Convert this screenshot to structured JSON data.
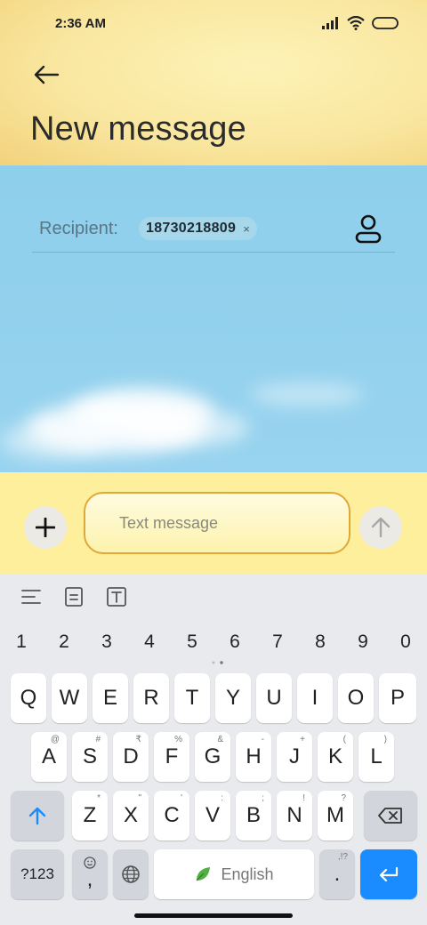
{
  "status_bar": {
    "time": "2:36 AM",
    "icons": [
      "signal-icon",
      "wifi-icon",
      "battery-icon"
    ]
  },
  "header": {
    "back_icon": "back-arrow-icon",
    "title": "New message"
  },
  "recipient": {
    "label": "Recipient:",
    "chip_number": "18730218809",
    "chip_close": "×",
    "contact_icon": "contact-person-icon"
  },
  "compose": {
    "add_icon": "plus-icon",
    "placeholder": "Text message",
    "value": "",
    "send_icon": "send-arrow-icon"
  },
  "keyboard": {
    "toolbar_icons": [
      "text-align-icon",
      "clipboard-icon",
      "text-format-icon"
    ],
    "number_row": [
      "1",
      "2",
      "3",
      "4",
      "5",
      "6",
      "7",
      "8",
      "9",
      "0"
    ],
    "row1": [
      "Q",
      "W",
      "E",
      "R",
      "T",
      "Y",
      "U",
      "I",
      "O",
      "P"
    ],
    "row2": [
      {
        "key": "A",
        "hint": "@"
      },
      {
        "key": "S",
        "hint": "#"
      },
      {
        "key": "D",
        "hint": "₹"
      },
      {
        "key": "F",
        "hint": "%"
      },
      {
        "key": "G",
        "hint": "&"
      },
      {
        "key": "H",
        "hint": "-"
      },
      {
        "key": "J",
        "hint": "+"
      },
      {
        "key": "K",
        "hint": "("
      },
      {
        "key": "L",
        "hint": ")"
      }
    ],
    "row3": [
      {
        "key": "Z",
        "hint": "*"
      },
      {
        "key": "X",
        "hint": "\""
      },
      {
        "key": "C",
        "hint": "'"
      },
      {
        "key": "V",
        "hint": ":"
      },
      {
        "key": "B",
        "hint": ";"
      },
      {
        "key": "N",
        "hint": "!"
      },
      {
        "key": "M",
        "hint": "?"
      }
    ],
    "symbols_label": "?123",
    "comma_label": ",",
    "space_label": "English",
    "period_label": ".",
    "period_hint": ",!?",
    "colors": {
      "enter_key": "#1a8cff",
      "shift_arrow": "#1a8cff"
    }
  }
}
